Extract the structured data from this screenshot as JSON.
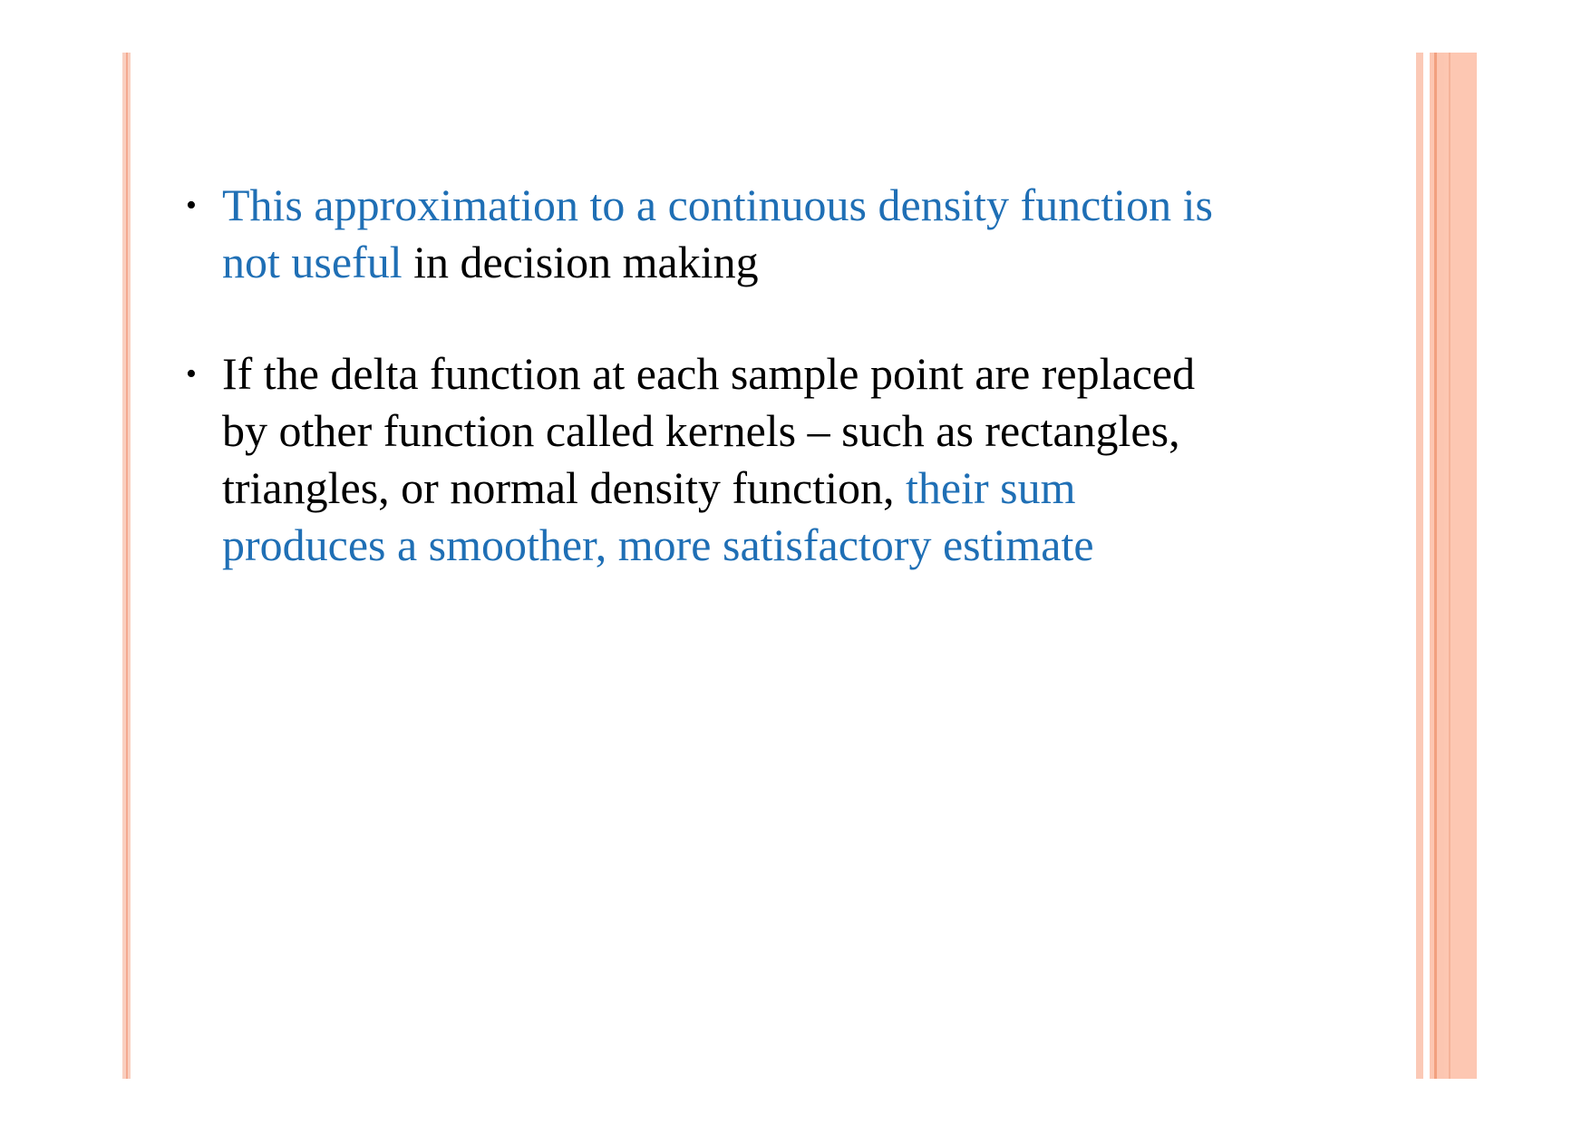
{
  "colors": {
    "highlight": "#1f6fb5",
    "text": "#000000",
    "border_light": "#fcc6b1",
    "border_dark": "#f2a07f"
  },
  "bullets": [
    {
      "symbol": "•",
      "line1_highlight": "This approximation to a continuous density function is",
      "line2_highlight": "not useful",
      "line2_plain": " in decision making"
    },
    {
      "symbol": "•",
      "line1_plain": "If the delta function at each sample point are replaced",
      "line2_plain": "by other function called kernels – such as rectangles,",
      "line3_plain": "triangles, or normal density function, ",
      "line3_highlight": "their sum",
      "line4_highlight": "produces a smoother, more satisfactory estimate"
    }
  ]
}
